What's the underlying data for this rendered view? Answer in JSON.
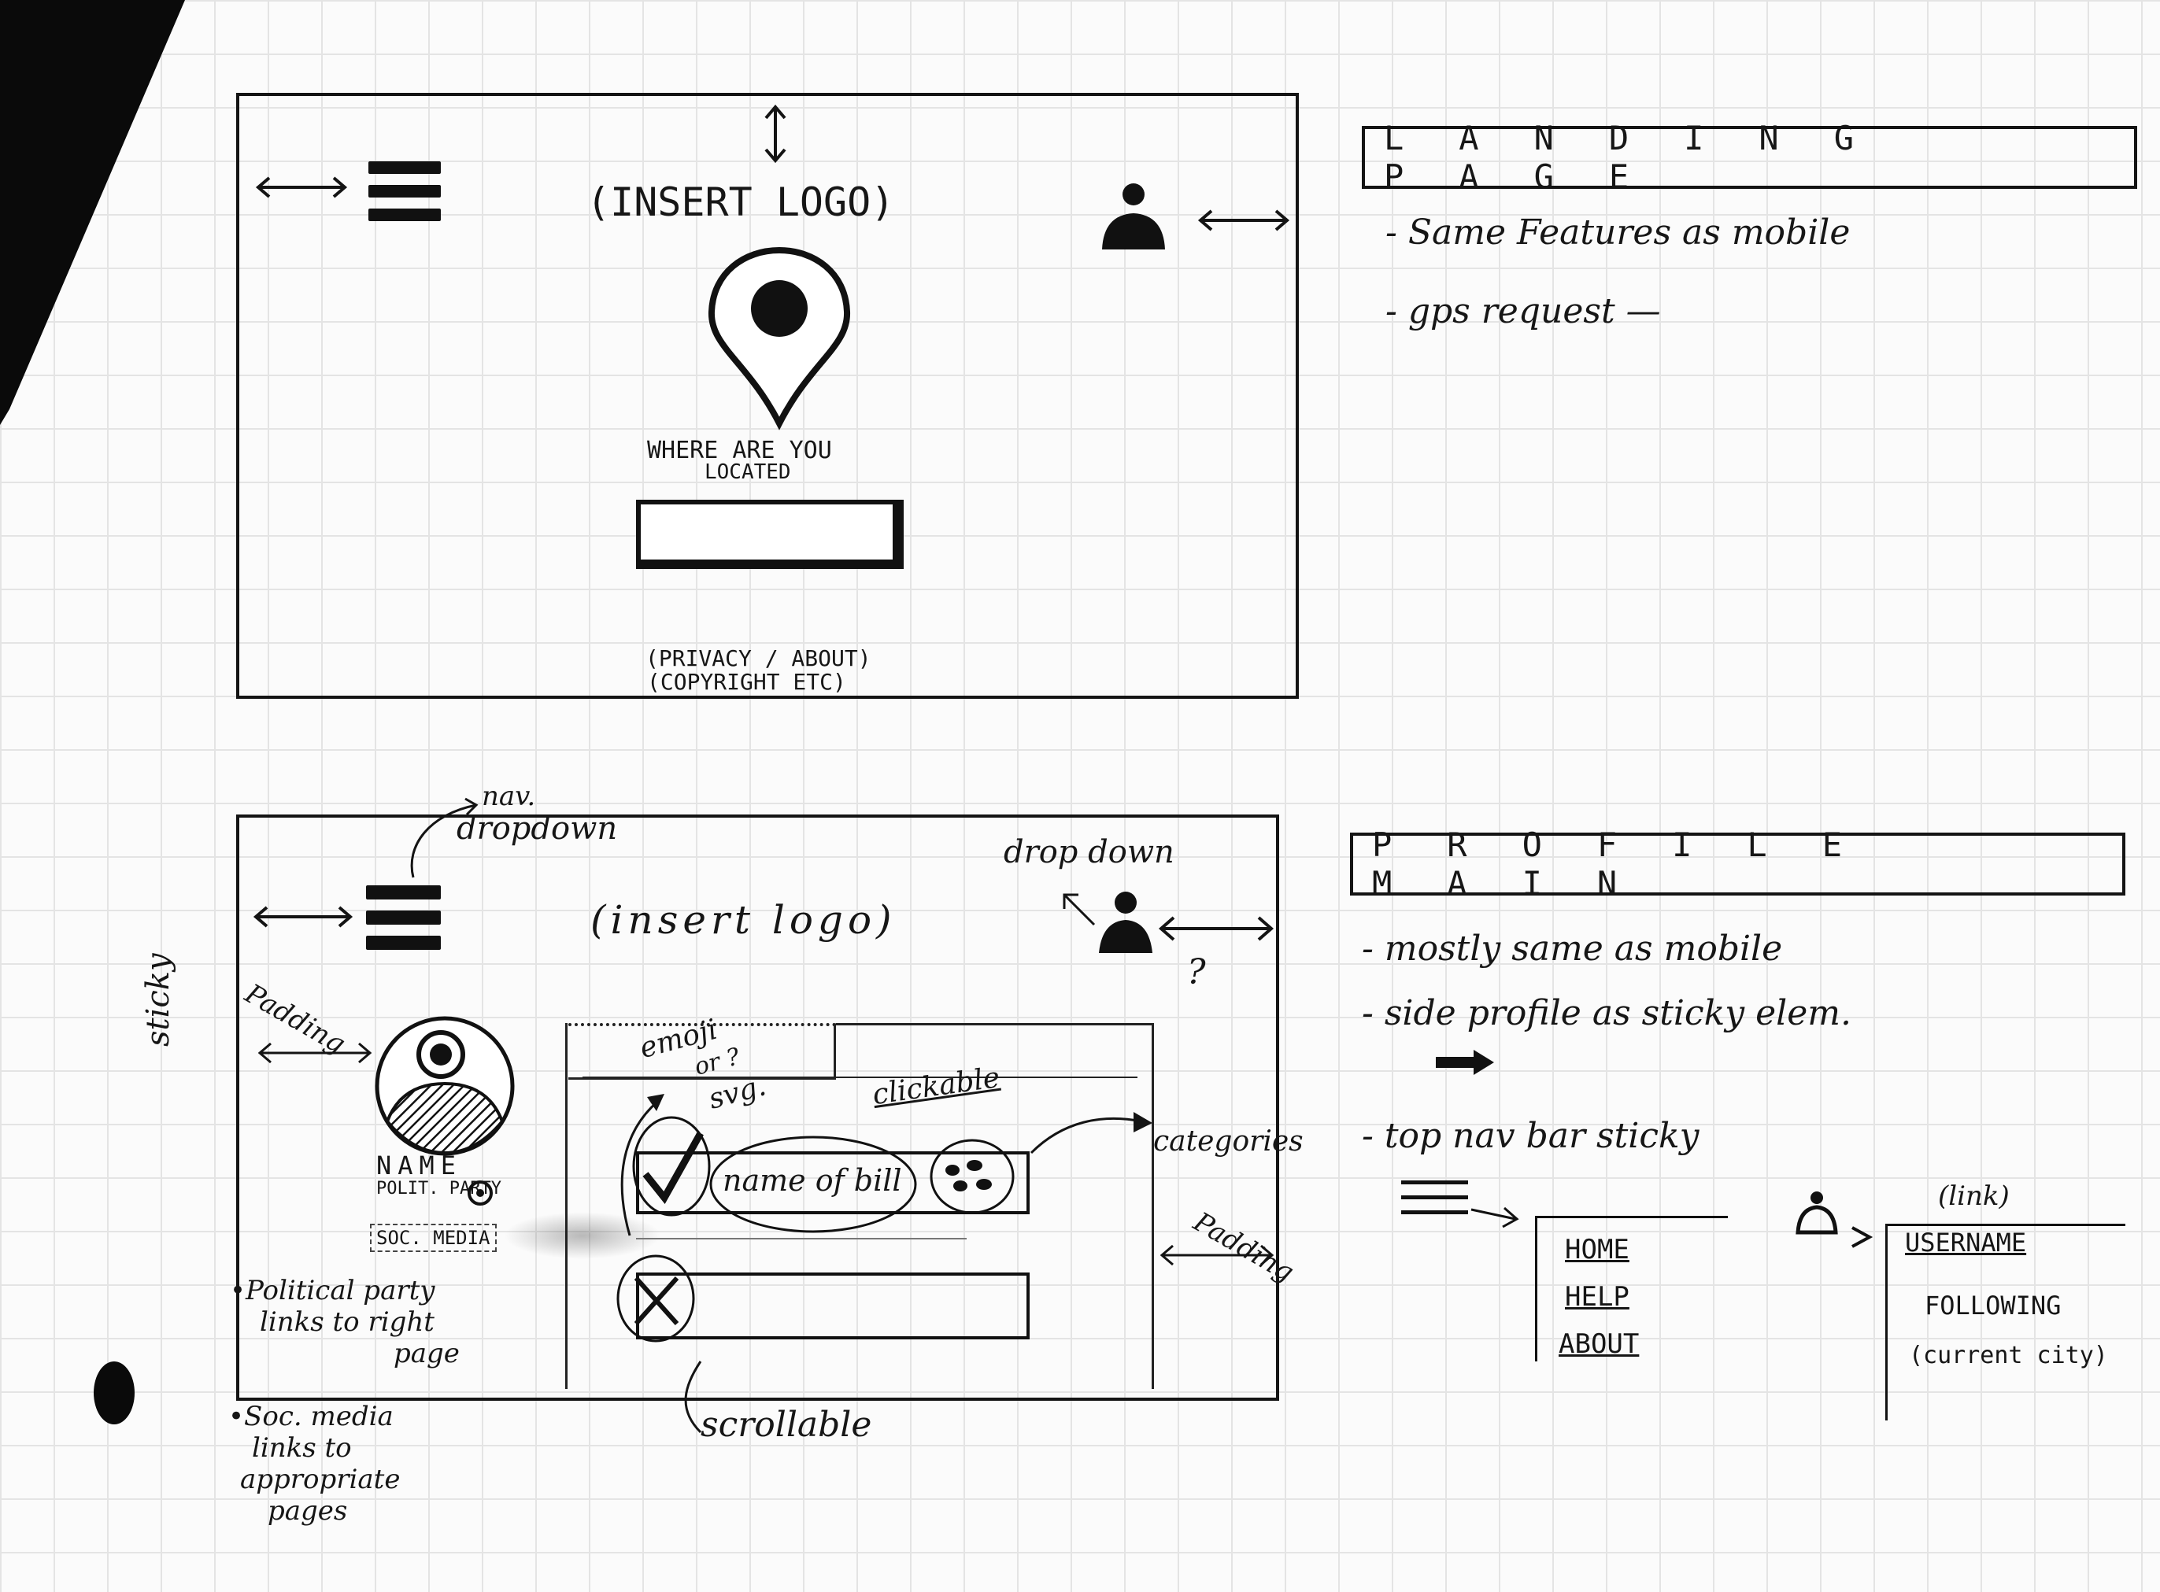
{
  "landing_sketch": {
    "logo_text": "(INSERT LOGO)",
    "prompt_line1": "WHERE ARE YOU",
    "prompt_line2": "LOCATED",
    "footer_line1": "(PRIVACY / ABOUT)",
    "footer_line2": "(COPYRIGHT ETC)",
    "icons": [
      "hamburger-menu-icon",
      "user-icon",
      "map-pin-icon",
      "double-arrow-icon"
    ]
  },
  "landing_notes": {
    "title": "LANDING PAGE",
    "items": [
      "- Same Features as mobile",
      "- gps request —"
    ]
  },
  "profile_sketch": {
    "logo_text": "(insert logo)",
    "nav_label_line1": "nav.",
    "nav_label_line2": "dropdown",
    "dropdown_label": "drop down",
    "question_mark": "?",
    "sticky_label": "sticky",
    "padding_left": "Padding",
    "padding_right": "Padding",
    "profile_name": "NAME",
    "profile_party": "POLIT. PARTY",
    "profile_social": "SOC. MEDIA",
    "emoji_label_line1": "emoji",
    "emoji_label_line2": "or ?",
    "emoji_label_line3": "svg.",
    "clickable_label": "clickable",
    "bill_label": "name of bill",
    "categories_label": "categories",
    "scrollable_label": "scrollable",
    "note_party_line1": "•Political party",
    "note_party_line2": "links to right",
    "note_party_line3": "page",
    "note_social_line1": "•Soc. media",
    "note_social_line2": "links to",
    "note_social_line3": "appropriate",
    "note_social_line4": "pages",
    "icons": [
      "check-icon",
      "x-icon",
      "avatar-icon",
      "user-icon",
      "hamburger-menu-icon"
    ]
  },
  "profile_notes": {
    "title": "PROFILE MAIN",
    "items": [
      "- mostly same as mobile",
      "- side profile as sticky elem.",
      "- top nav bar sticky"
    ],
    "nav_menu": [
      "HOME",
      "HELP",
      "ABOUT"
    ],
    "user_menu_header": "(link)",
    "user_menu": [
      "USERNAME",
      "FOLLOWING",
      "(current city)"
    ]
  },
  "colors": {
    "ink": "#141414",
    "paper": "#fbfbfb",
    "grid": "#e4e4e4"
  }
}
